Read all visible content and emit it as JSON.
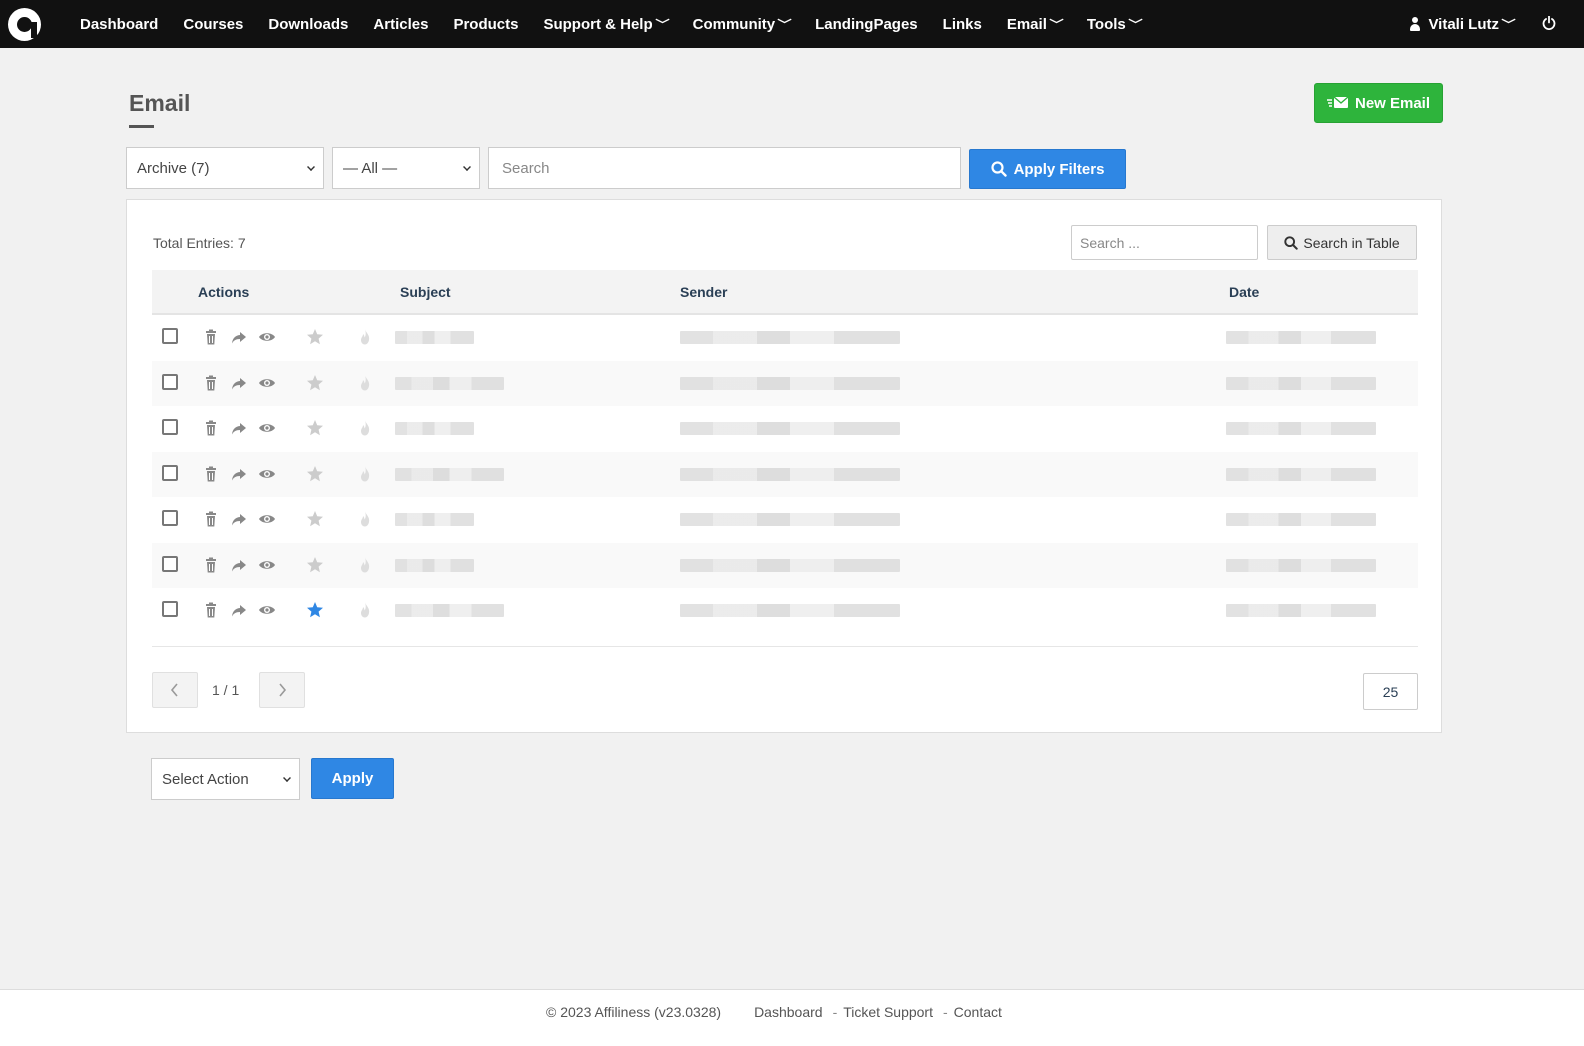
{
  "nav": {
    "items": [
      {
        "label": "Dashboard",
        "dropdown": false
      },
      {
        "label": "Courses",
        "dropdown": false
      },
      {
        "label": "Downloads",
        "dropdown": false
      },
      {
        "label": "Articles",
        "dropdown": false
      },
      {
        "label": "Products",
        "dropdown": false
      },
      {
        "label": "Support & Help",
        "dropdown": true
      },
      {
        "label": "Community",
        "dropdown": true
      },
      {
        "label": "LandingPages",
        "dropdown": false
      },
      {
        "label": "Links",
        "dropdown": false
      },
      {
        "label": "Email",
        "dropdown": true
      },
      {
        "label": "Tools",
        "dropdown": true
      }
    ],
    "user_name": "Vitali Lutz",
    "chevron": "﹀"
  },
  "page": {
    "title": "Email",
    "new_button_label": "New Email"
  },
  "filters": {
    "folder_value": "Archive (7)",
    "type_value": "— All —",
    "search_placeholder": "Search",
    "apply_label": "Apply Filters"
  },
  "table": {
    "total_label": "Total Entries: 7",
    "search_placeholder": "Search ...",
    "search_button_label": "Search in Table",
    "columns": {
      "actions": "Actions",
      "subject": "Subject",
      "sender": "Sender",
      "date": "Date"
    },
    "rows": [
      {
        "starred": false,
        "subject_len": "short"
      },
      {
        "starred": false,
        "subject_len": "long"
      },
      {
        "starred": false,
        "subject_len": "short"
      },
      {
        "starred": false,
        "subject_len": "long"
      },
      {
        "starred": false,
        "subject_len": "short"
      },
      {
        "starred": false,
        "subject_len": "short"
      },
      {
        "starred": true,
        "subject_len": "long"
      }
    ],
    "pagination_text": "1 / 1",
    "per_page": "25"
  },
  "bulk": {
    "select_value": "Select Action",
    "apply_label": "Apply"
  },
  "footer": {
    "copyright": "© 2023 Affiliness (v23.0328)",
    "links": [
      "Dashboard",
      "Ticket Support",
      "Contact"
    ]
  },
  "colors": {
    "topbar": "#111111",
    "accent_blue": "#2f87e4",
    "new_green": "#2eb43c",
    "star_active": "#2f87e4",
    "star_inactive": "#cccccc"
  },
  "icons": {
    "row_actions": [
      "trash-icon",
      "forward-icon",
      "eye-icon",
      "star-icon",
      "fire-icon"
    ]
  }
}
